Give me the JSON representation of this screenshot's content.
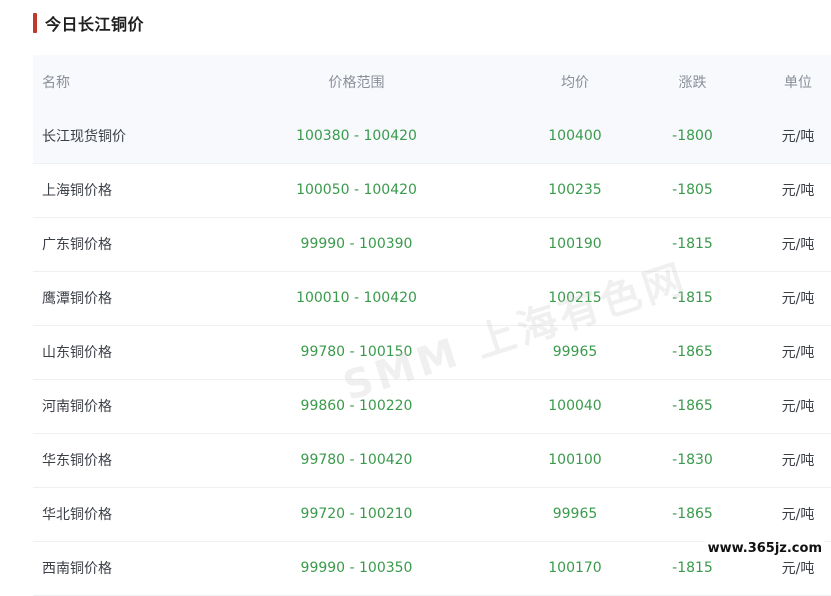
{
  "section": {
    "title": "今日长江铜价"
  },
  "table": {
    "headers": {
      "name": "名称",
      "range": "价格范围",
      "avg": "均价",
      "change": "涨跌",
      "unit": "单位"
    },
    "rows": [
      {
        "name": "长江现货铜价",
        "range": "100380 - 100420",
        "avg": "100400",
        "change": "-1800",
        "unit": "元/吨"
      },
      {
        "name": "上海铜价格",
        "range": "100050 - 100420",
        "avg": "100235",
        "change": "-1805",
        "unit": "元/吨"
      },
      {
        "name": "广东铜价格",
        "range": "99990 - 100390",
        "avg": "100190",
        "change": "-1815",
        "unit": "元/吨"
      },
      {
        "name": "鹰潭铜价格",
        "range": "100010 - 100420",
        "avg": "100215",
        "change": "-1815",
        "unit": "元/吨"
      },
      {
        "name": "山东铜价格",
        "range": "99780 - 100150",
        "avg": "99965",
        "change": "-1865",
        "unit": "元/吨"
      },
      {
        "name": "河南铜价格",
        "range": "99860 - 100220",
        "avg": "100040",
        "change": "-1865",
        "unit": "元/吨"
      },
      {
        "name": "华东铜价格",
        "range": "99780 - 100420",
        "avg": "100100",
        "change": "-1830",
        "unit": "元/吨"
      },
      {
        "name": "华北铜价格",
        "range": "99720 - 100210",
        "avg": "99965",
        "change": "-1865",
        "unit": "元/吨"
      },
      {
        "name": "西南铜价格",
        "range": "99990 - 100350",
        "avg": "100170",
        "change": "-1815",
        "unit": "元/吨"
      }
    ]
  },
  "watermark": "SMM 上海有色网",
  "site_mark": "www.365jz.com",
  "colors": {
    "accent": "#c0392b",
    "value_green": "#3a9a4c",
    "header_bg": "#f7f9fc"
  }
}
